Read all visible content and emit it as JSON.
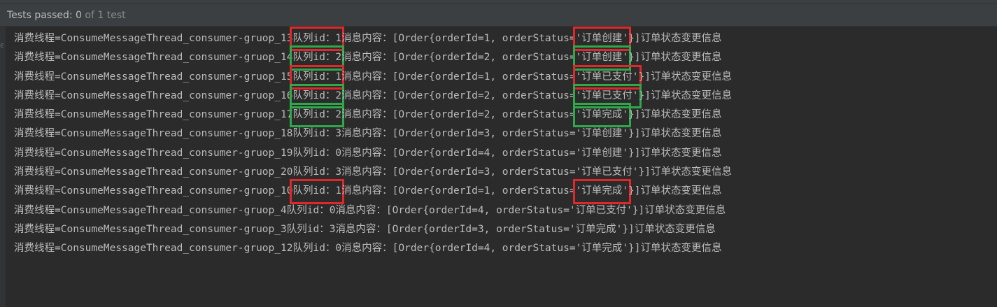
{
  "status": {
    "label": "Tests passed:",
    "passed": "0",
    "rest": "of 1 test"
  },
  "gutter_mark": "e",
  "console": {
    "lines": [
      {
        "prefix": "消费线程=ConsumeMessageThread_consumer-gruop_13",
        "queue": "队列id：1",
        "mid": "消息内容：[Order{orderId=1, orderStatus=",
        "status": "'订单创建'",
        "suffix": "}]订单状态变更信息",
        "queue_box": "red",
        "status_box": "red"
      },
      {
        "prefix": "消费线程=ConsumeMessageThread_consumer-gruop_14",
        "queue": "队列id：2",
        "mid": "消息内容：[Order{orderId=2, orderStatus=",
        "status": "'订单创建'",
        "suffix": "}]订单状态变更信息",
        "queue_box": "green",
        "status_box": "green"
      },
      {
        "prefix": "消费线程=ConsumeMessageThread_consumer-gruop_15",
        "queue": "队列id：1",
        "mid": "消息内容：[Order{orderId=1, orderStatus=",
        "status": "'订单已支付'",
        "suffix": "}]订单状态变更信息",
        "queue_box": "red",
        "status_box": "red"
      },
      {
        "prefix": "消费线程=ConsumeMessageThread_consumer-gruop_16",
        "queue": "队列id：2",
        "mid": "消息内容：[Order{orderId=2, orderStatus=",
        "status": "'订单已支付'",
        "suffix": "}]订单状态变更信息",
        "queue_box": "green",
        "status_box": "green"
      },
      {
        "prefix": "消费线程=ConsumeMessageThread_consumer-gruop_17",
        "queue": "队列id：2",
        "mid": "消息内容：[Order{orderId=2, orderStatus=",
        "status": "'订单完成'",
        "suffix": "}]订单状态变更信息",
        "queue_box": "green",
        "status_box": "green"
      },
      {
        "prefix": "消费线程=ConsumeMessageThread_consumer-gruop_18",
        "queue": "队列id：3",
        "mid": "消息内容：[Order{orderId=3, orderStatus=",
        "status": "'订单创建'",
        "suffix": "}]订单状态变更信息",
        "queue_box": "",
        "status_box": ""
      },
      {
        "prefix": "消费线程=ConsumeMessageThread_consumer-gruop_19",
        "queue": "队列id：0",
        "mid": "消息内容：[Order{orderId=4, orderStatus=",
        "status": "'订单创建'",
        "suffix": "}]订单状态变更信息",
        "queue_box": "",
        "status_box": ""
      },
      {
        "prefix": "消费线程=ConsumeMessageThread_consumer-gruop_20",
        "queue": "队列id：3",
        "mid": "消息内容：[Order{orderId=3, orderStatus=",
        "status": "'订单已支付'",
        "suffix": "}]订单状态变更信息",
        "queue_box": "",
        "status_box": ""
      },
      {
        "prefix": "消费线程=ConsumeMessageThread_consumer-gruop_10",
        "queue": "队列id：1",
        "mid": "消息内容：[Order{orderId=1, orderStatus=",
        "status": "'订单完成'",
        "suffix": "}]订单状态变更信息",
        "queue_box": "red",
        "status_box": "red"
      },
      {
        "prefix": "消费线程=ConsumeMessageThread_consumer-gruop_4",
        "queue": "队列id：0",
        "mid": "消息内容：[Order{orderId=4, orderStatus=",
        "status": "'订单已支付'",
        "suffix": "}]订单状态变更信息",
        "queue_box": "",
        "status_box": ""
      },
      {
        "prefix": "消费线程=ConsumeMessageThread_consumer-gruop_3",
        "queue": "队列id：3",
        "mid": "消息内容：[Order{orderId=3, orderStatus=",
        "status": "'订单完成'",
        "suffix": "}]订单状态变更信息",
        "queue_box": "",
        "status_box": ""
      },
      {
        "prefix": "消费线程=ConsumeMessageThread_consumer-gruop_12",
        "queue": "队列id：0",
        "mid": "消息内容：[Order{orderId=4, orderStatus=",
        "status": "'订单完成'",
        "suffix": "}]订单状态变更信息",
        "queue_box": "",
        "status_box": ""
      }
    ]
  },
  "colors": {
    "background": "#2b2b2b",
    "text": "#bbbbbb",
    "highlight_red": "#e0282a",
    "highlight_green": "#2fa84a"
  }
}
